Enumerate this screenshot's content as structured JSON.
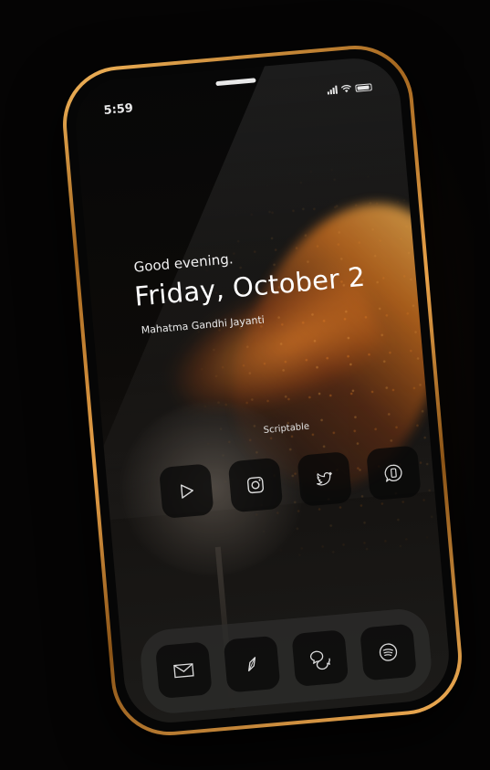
{
  "status_bar": {
    "time": "5:59",
    "signal_bars": 4,
    "wifi_icon": "wifi-icon",
    "battery_level": 0.9
  },
  "widget": {
    "greeting": "Good evening.",
    "date": "Friday, October 2",
    "holiday": "Mahatma Gandhi Jayanti"
  },
  "home_screen": {
    "widget_label": "Scriptable",
    "apps": [
      {
        "name": "YouTube",
        "icon": "play-icon"
      },
      {
        "name": "Instagram",
        "icon": "camera-icon"
      },
      {
        "name": "Twitter",
        "icon": "bird-icon"
      },
      {
        "name": "WhatsApp",
        "icon": "chat-bubble-phone-icon"
      }
    ]
  },
  "dock": {
    "apps": [
      {
        "name": "Mail",
        "icon": "mail-icon"
      },
      {
        "name": "Safari",
        "icon": "compass-icon"
      },
      {
        "name": "Messages",
        "icon": "messages-icon"
      },
      {
        "name": "Spotify",
        "icon": "spotify-icon"
      }
    ]
  },
  "colors": {
    "frame_gold": "#e8a24a",
    "screen_bg": "#070707",
    "accent_flame": "#f08a20",
    "text": "#ffffff"
  }
}
